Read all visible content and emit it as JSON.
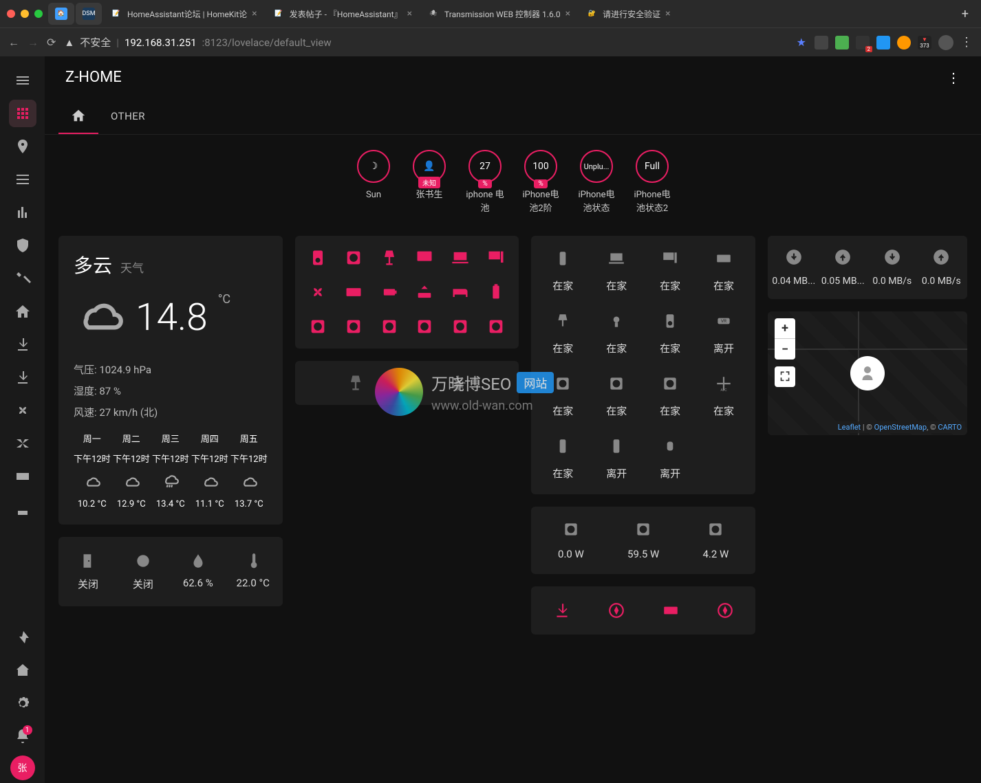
{
  "browser": {
    "tabs": [
      {
        "icon": "🏠",
        "bg": "#3f9fff",
        "label": ""
      },
      {
        "icon": "DSM",
        "bg": "#1a3a5a",
        "label": ""
      },
      {
        "icon": "📝",
        "bg": "#f9a825",
        "label": "HomeAssistant论坛 | HomeKit论"
      },
      {
        "icon": "📝",
        "bg": "#f9a825",
        "label": "发表帖子 - 『HomeAssistant』"
      },
      {
        "icon": "🕷",
        "bg": "#333",
        "label": "Transmission WEB 控制器 1.6.0"
      },
      {
        "icon": "🔐",
        "bg": "#333",
        "label": "请进行安全验证"
      }
    ],
    "url_warn": "不安全",
    "url": "192.168.31.251",
    "url_path": ":8123/lovelace/default_view",
    "ext_badge_2": "2",
    "ext_badge_373": "373"
  },
  "sidebar": {
    "bell_badge": "1",
    "avatar": "张"
  },
  "header": {
    "title": "Z-HOME",
    "tab_other": "OTHER"
  },
  "badges": [
    {
      "val": "☽",
      "label": "Sun"
    },
    {
      "val": "👤",
      "sub": "未知",
      "label": "张书生"
    },
    {
      "val": "27",
      "sub": "%",
      "label": "iphone 电池"
    },
    {
      "val": "100",
      "sub": "%",
      "label": "iPhone电池2阶"
    },
    {
      "val": "Unplu...",
      "label": "iPhone电池状态"
    },
    {
      "val": "Full",
      "label": "iPhone电池状态2"
    }
  ],
  "weather": {
    "cond": "多云",
    "sub": "天气",
    "temp": "14.8",
    "unit": "°C",
    "pressure": "气压: 1024.9 hPa",
    "humidity": "湿度: 87 %",
    "wind": "风速: 27 km/h (北)",
    "forecast": [
      {
        "day": "周一",
        "time": "下午12时",
        "temp": "10.2 °C"
      },
      {
        "day": "周二",
        "time": "下午12时",
        "temp": "12.9 °C"
      },
      {
        "day": "周三",
        "time": "下午12时",
        "temp": "13.4 °C"
      },
      {
        "day": "周四",
        "time": "下午12时",
        "temp": "11.1 °C"
      },
      {
        "day": "周五",
        "time": "下午12时",
        "temp": "13.7 °C"
      }
    ]
  },
  "sensors": [
    {
      "v": "关闭"
    },
    {
      "v": "关闭"
    },
    {
      "v": "62.6 %"
    },
    {
      "v": "22.0 °C"
    }
  ],
  "presence": [
    {
      "v": "在家"
    },
    {
      "v": "在家"
    },
    {
      "v": "在家"
    },
    {
      "v": "在家"
    },
    {
      "v": "在家"
    },
    {
      "v": "在家"
    },
    {
      "v": "在家"
    },
    {
      "v": "离开"
    },
    {
      "v": "在家"
    },
    {
      "v": "在家"
    },
    {
      "v": "在家"
    },
    {
      "v": "在家"
    },
    {
      "v": "在家"
    },
    {
      "v": "离开"
    },
    {
      "v": "离开"
    }
  ],
  "power": [
    {
      "v": "0.0 W"
    },
    {
      "v": "59.5 W"
    },
    {
      "v": "4.2 W"
    }
  ],
  "speeds": [
    {
      "v": "0.04 MB..."
    },
    {
      "v": "0.05 MB..."
    },
    {
      "v": "0.0 MB/s"
    },
    {
      "v": "0.0 MB/s"
    }
  ],
  "map": {
    "plus": "+",
    "minus": "−",
    "fs": "⛶",
    "attr_leaflet": "Leaflet",
    "attr_sep": " | © ",
    "attr_osm": "OpenStreetMap",
    "attr_sep2": ", © ",
    "attr_carto": "CARTO"
  },
  "watermark": {
    "t1": "万晓博SEO",
    "badge": "网站",
    "t2": "www.old-wan.com"
  }
}
